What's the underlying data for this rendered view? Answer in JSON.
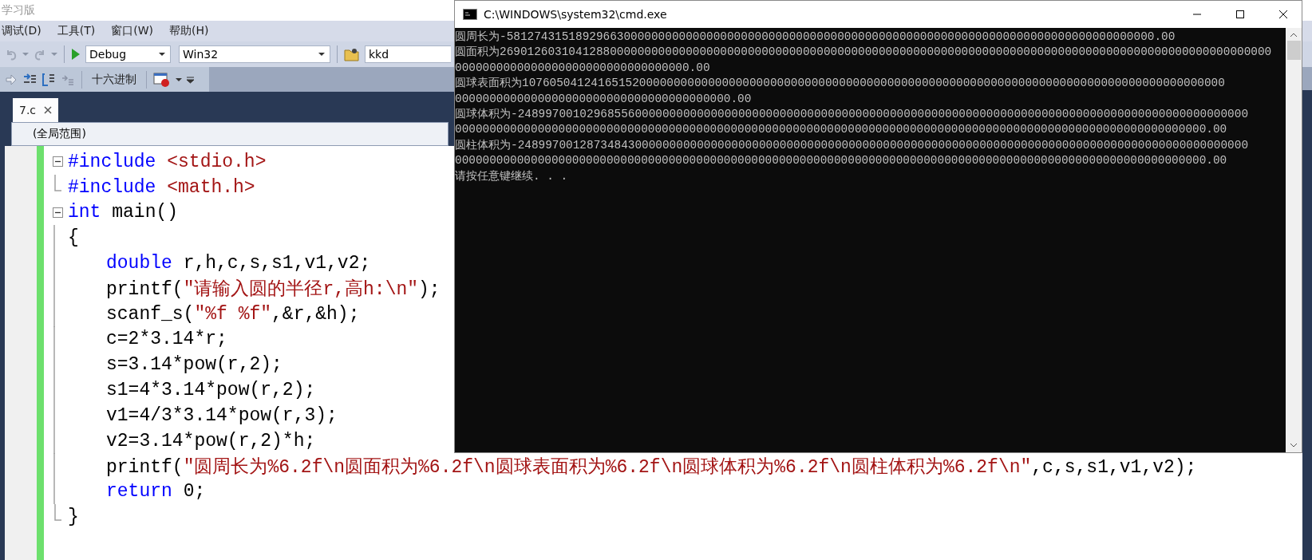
{
  "ide": {
    "title": "学习版",
    "menu": [
      {
        "label": "调试(D)"
      },
      {
        "label": "工具(T)"
      },
      {
        "label": "窗口(W)"
      },
      {
        "label": "帮助(H)"
      }
    ],
    "toolbar": {
      "configuration": "Debug",
      "platform": "Win32",
      "find_value": "kkd",
      "hex_button": "十六进制"
    },
    "tabs": [
      {
        "label": "7.c",
        "selected": true
      }
    ],
    "scope": "(全局范围)",
    "code_lines": [
      {
        "collapsible": true,
        "indented": false,
        "segments": [
          {
            "kind": "preproc",
            "text": "#include"
          },
          {
            "kind": "string",
            "text": " <stdio.h>"
          }
        ]
      },
      {
        "collapsible": false,
        "fold_end": true,
        "indented": false,
        "segments": [
          {
            "kind": "preproc",
            "text": "#include"
          },
          {
            "kind": "string",
            "text": " <math.h>"
          }
        ]
      },
      {
        "collapsible": true,
        "indented": false,
        "segments": [
          {
            "kind": "keyword",
            "text": "int"
          },
          {
            "kind": "plain",
            "text": " main()"
          }
        ]
      },
      {
        "collapsible": false,
        "fold_end": false,
        "indented": false,
        "segments": [
          {
            "kind": "plain",
            "text": "{"
          }
        ]
      },
      {
        "collapsible": false,
        "fold_end": false,
        "indented": true,
        "segments": [
          {
            "kind": "keyword",
            "text": "double"
          },
          {
            "kind": "plain",
            "text": " r,h,c,s,s1,v1,v2;"
          }
        ]
      },
      {
        "collapsible": false,
        "fold_end": false,
        "indented": true,
        "segments": [
          {
            "kind": "plain",
            "text": "printf("
          },
          {
            "kind": "string",
            "text": "\"请输入圆的半径r,高h:\\n\""
          },
          {
            "kind": "plain",
            "text": ");"
          }
        ]
      },
      {
        "collapsible": false,
        "fold_end": false,
        "indented": true,
        "segments": [
          {
            "kind": "plain",
            "text": "scanf_s("
          },
          {
            "kind": "string",
            "text": "\"%f %f\""
          },
          {
            "kind": "plain",
            "text": ",&r,&h);"
          }
        ]
      },
      {
        "collapsible": false,
        "fold_end": false,
        "indented": true,
        "segments": [
          {
            "kind": "plain",
            "text": "c=2*3.14*r;"
          }
        ]
      },
      {
        "collapsible": false,
        "fold_end": false,
        "indented": true,
        "segments": [
          {
            "kind": "plain",
            "text": "s=3.14*pow(r,2);"
          }
        ]
      },
      {
        "collapsible": false,
        "fold_end": false,
        "indented": true,
        "segments": [
          {
            "kind": "plain",
            "text": "s1=4*3.14*pow(r,2);"
          }
        ]
      },
      {
        "collapsible": false,
        "fold_end": false,
        "indented": true,
        "segments": [
          {
            "kind": "plain",
            "text": "v1=4/3*3.14*pow(r,3);"
          }
        ]
      },
      {
        "collapsible": false,
        "fold_end": false,
        "indented": true,
        "segments": [
          {
            "kind": "plain",
            "text": "v2=3.14*pow(r,2)*h;"
          }
        ]
      },
      {
        "collapsible": false,
        "fold_end": false,
        "indented": true,
        "segments": [
          {
            "kind": "plain",
            "text": "printf("
          },
          {
            "kind": "string",
            "text": "\"圆周长为%6.2f\\n圆面积为%6.2f\\n圆球表面积为%6.2f\\n圆球体积为%6.2f\\n圆柱体积为%6.2f\\n\""
          },
          {
            "kind": "plain",
            "text": ",c,s,s1,v1,v2);"
          }
        ]
      },
      {
        "collapsible": false,
        "fold_end": false,
        "indented": true,
        "segments": [
          {
            "kind": "keyword",
            "text": "return"
          },
          {
            "kind": "plain",
            "text": " 0;"
          }
        ]
      },
      {
        "collapsible": false,
        "fold_end": true,
        "indented": false,
        "segments": [
          {
            "kind": "plain",
            "text": "}"
          }
        ]
      }
    ]
  },
  "console": {
    "title": "C:\\WINDOWS\\system32\\cmd.exe",
    "lines": [
      "圆周长为-5812743151892966300000000000000000000000000000000000000000000000000000000000000000000000000000.00",
      "圆面积为2690126031041288000000000000000000000000000000000000000000000000000000000000000000000000000000000000000000000000",
      "0000000000000000000000000000000000.00",
      "圆球表面积为107605041241651520000000000000000000000000000000000000000000000000000000000000000000000000000000000000",
      "0000000000000000000000000000000000000000.00",
      "圆球体积为-2489970010296855600000000000000000000000000000000000000000000000000000000000000000000000000000000000000000",
      "0000000000000000000000000000000000000000000000000000000000000000000000000000000000000000000000000000000000000.00",
      "圆柱体积为-2489970012873484300000000000000000000000000000000000000000000000000000000000000000000000000000000000000000",
      "0000000000000000000000000000000000000000000000000000000000000000000000000000000000000000000000000000000000000.00",
      "请按任意键继续. . ."
    ]
  }
}
